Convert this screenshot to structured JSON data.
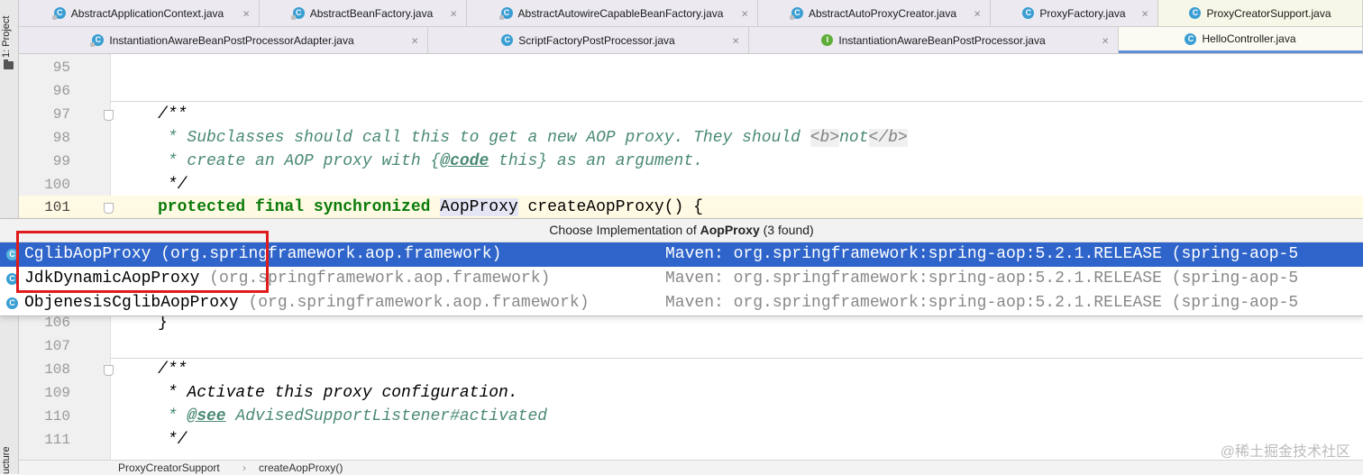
{
  "side_panel": {
    "project_label": "1: Project",
    "structure_label": "ucture"
  },
  "tabs_row1": [
    {
      "label": "AbstractApplicationContext.java",
      "icon": "class-icon",
      "abstract": true
    },
    {
      "label": "AbstractBeanFactory.java",
      "icon": "class-icon",
      "abstract": true
    },
    {
      "label": "AbstractAutowireCapableBeanFactory.java",
      "icon": "class-icon",
      "abstract": true
    },
    {
      "label": "AbstractAutoProxyCreator.java",
      "icon": "class-icon",
      "abstract": true
    },
    {
      "label": "ProxyFactory.java",
      "icon": "class-icon",
      "abstract": false
    },
    {
      "label": "ProxyCreatorSupport.java",
      "icon": "class-icon",
      "abstract": false
    }
  ],
  "tabs_row2": [
    {
      "label": "InstantiationAwareBeanPostProcessorAdapter.java",
      "icon": "class-icon",
      "abstract": true
    },
    {
      "label": "ScriptFactoryPostProcessor.java",
      "icon": "class-icon",
      "abstract": false
    },
    {
      "label": "InstantiationAwareBeanPostProcessor.java",
      "icon": "interface-icon",
      "abstract": false
    },
    {
      "label": "HelloController.java",
      "icon": "class-icon",
      "abstract": false
    }
  ],
  "close_glyph": "×",
  "class_glyph": "C",
  "interface_glyph": "I",
  "code_lines": {
    "l95": {
      "num": "95"
    },
    "l96": {
      "num": "96"
    },
    "l97": {
      "num": "97",
      "text": "/**"
    },
    "l98": {
      "num": "98",
      "text_a": " * Subclasses should call this to get a new AOP proxy. They should ",
      "tag1": "<b>",
      "word": "not",
      "tag2": "</b>"
    },
    "l99": {
      "num": "99",
      "text_a": " * create an AOP proxy with {",
      "tag": "@code",
      "text_b": " this} as an argument."
    },
    "l100": {
      "num": "100",
      "text": " */"
    },
    "l101": {
      "num": "101",
      "kw": "protected final synchronized",
      "type": "AopProxy",
      "rest": " createAopProxy() {"
    },
    "l106": {
      "num": "106",
      "text": "}"
    },
    "l107": {
      "num": "107"
    },
    "l108": {
      "num": "108",
      "text": "/**"
    },
    "l109": {
      "num": "109",
      "text": " * Activate this proxy configuration."
    },
    "l110": {
      "num": "110",
      "text_a": " * ",
      "tag": "@see",
      "text_b": " AdvisedSupportListener#activated"
    },
    "l111": {
      "num": "111",
      "text": " */"
    }
  },
  "popup": {
    "title_prefix": "Choose Implementation of ",
    "title_type": "AopProxy",
    "title_suffix": " (3 found)",
    "items": [
      {
        "name": "CglibAopProxy",
        "pkg": " (org.springframework.aop.framework)",
        "maven": "Maven: org.springframework:spring-aop:5.2.1.RELEASE (spring-aop-5",
        "selected": true
      },
      {
        "name": "JdkDynamicAopProxy",
        "pkg": " (org.springframework.aop.framework)",
        "maven": "Maven: org.springframework:spring-aop:5.2.1.RELEASE (spring-aop-5",
        "selected": false
      },
      {
        "name": "ObjenesisCglibAopProxy",
        "pkg": " (org.springframework.aop.framework)",
        "maven": "Maven: org.springframework:spring-aop:5.2.1.RELEASE (spring-aop-5",
        "selected": false
      }
    ]
  },
  "breadcrumb": {
    "class_name": "ProxyCreatorSupport",
    "method_name": "createAopProxy()"
  },
  "watermark": "@稀土掘金技术社区",
  "colors": {
    "selection": "#2f65ca",
    "annotation_box": "#e01b1b",
    "keyword": "#0a7b0a",
    "doc_comment": "#4a8a73"
  }
}
